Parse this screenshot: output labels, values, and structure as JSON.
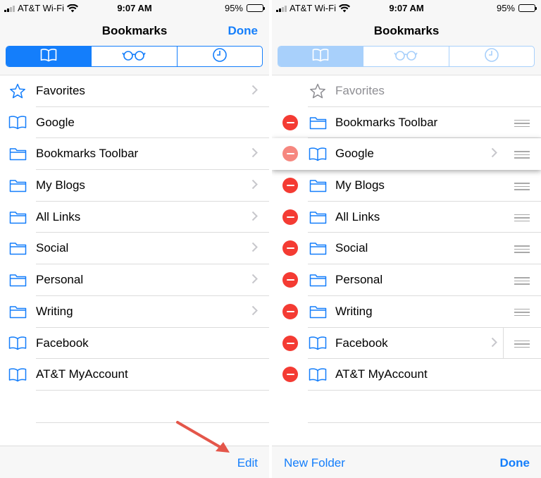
{
  "colors": {
    "accent": "#147efb",
    "delete": "#f43b33",
    "annotation_arrow": "#e4564a"
  },
  "status": {
    "carrier": "AT&T Wi-Fi",
    "time": "9:07 AM",
    "battery": "95%",
    "battery_level": 0.95
  },
  "left": {
    "nav_title": "Bookmarks",
    "nav_done": "Done",
    "segments": [
      {
        "icon": "book-icon",
        "active": true
      },
      {
        "icon": "glasses-icon",
        "active": false
      },
      {
        "icon": "clock-icon",
        "active": false
      }
    ],
    "rows": [
      {
        "label": "Favorites",
        "icon": "star-icon",
        "chevron": true
      },
      {
        "label": "Google",
        "icon": "book-icon",
        "chevron": false
      },
      {
        "label": "Bookmarks Toolbar",
        "icon": "folder-icon",
        "chevron": true
      },
      {
        "label": "My Blogs",
        "icon": "folder-icon",
        "chevron": true
      },
      {
        "label": "All Links",
        "icon": "folder-icon",
        "chevron": true
      },
      {
        "label": "Social",
        "icon": "folder-icon",
        "chevron": true
      },
      {
        "label": "Personal",
        "icon": "folder-icon",
        "chevron": true
      },
      {
        "label": "Writing",
        "icon": "folder-icon",
        "chevron": true
      },
      {
        "label": "Facebook",
        "icon": "book-icon",
        "chevron": false
      },
      {
        "label": "AT&T MyAccount",
        "icon": "book-icon",
        "chevron": false
      }
    ],
    "toolbar_edit": "Edit"
  },
  "right": {
    "nav_title": "Bookmarks",
    "rows": [
      {
        "label": "Favorites",
        "icon": "star-icon",
        "disabled": true
      },
      {
        "label": "Bookmarks Toolbar",
        "icon": "folder-icon"
      },
      {
        "label": "Google",
        "icon": "book-icon",
        "dragging": true,
        "chevron": true
      },
      {
        "label": "My Blogs",
        "icon": "folder-icon"
      },
      {
        "label": "All Links",
        "icon": "folder-icon"
      },
      {
        "label": "Social",
        "icon": "folder-icon"
      },
      {
        "label": "Personal",
        "icon": "folder-icon"
      },
      {
        "label": "Writing",
        "icon": "folder-icon"
      },
      {
        "label": "Facebook",
        "icon": "book-icon",
        "chevron": true
      },
      {
        "label": "AT&T MyAccount",
        "icon": "book-icon"
      }
    ],
    "toolbar_new_folder": "New Folder",
    "toolbar_done": "Done"
  }
}
